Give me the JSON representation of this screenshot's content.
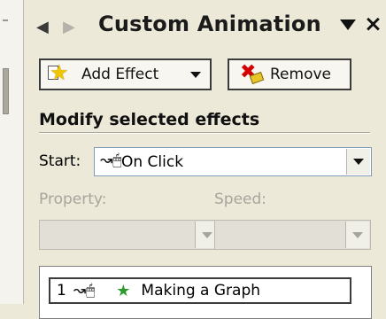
{
  "pane": {
    "title": "Custom Animation",
    "back_glyph": "◆",
    "forward_glyph": "◆",
    "close_glyph": "✕"
  },
  "toolbar": {
    "add_effect_label": "Add Effect",
    "remove_label": "Remove"
  },
  "section": {
    "heading": "Modify selected effects"
  },
  "start": {
    "label": "Start:",
    "value": "On Click",
    "icon": "mouse-click-icon"
  },
  "property": {
    "label": "Property:",
    "value": ""
  },
  "speed": {
    "label": "Speed:",
    "value": ""
  },
  "effects_list": {
    "items": [
      {
        "number": "1",
        "trigger_icon": "mouse-click-icon",
        "effect_icon": "effect-star-icon",
        "name": "Making a Graph"
      }
    ]
  },
  "colors": {
    "pane_bg": "#ece9d8",
    "combo_border": "#7f9db9",
    "disabled_text": "#a8a69c",
    "star_yellow": "#f2c500",
    "remove_x_red": "#d40000",
    "effect_star_green": "#2e9b2e"
  }
}
